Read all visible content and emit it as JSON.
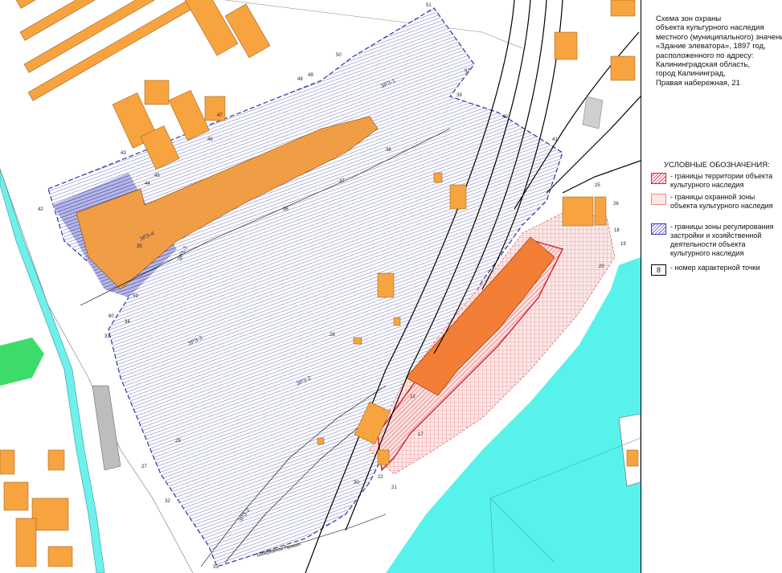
{
  "title": {
    "lines": [
      "Схема зон охраны",
      "объекта культурного наследия",
      "местного (муниципального) значения",
      "«Здание элеватора», 1897 год,",
      "расположенного по адресу:",
      "Калининградская область,",
      "город Калининград,",
      "Правая набережная, 21"
    ]
  },
  "legend": {
    "heading": "УСЛОВНЫЕ ОБОЗНАЧЕНИЯ:",
    "items": [
      {
        "swatch": "red-hatch",
        "text": "- границы территории объекта культурного наследия"
      },
      {
        "swatch": "pink",
        "text": "- границы охранной зоны объекта культурного наследия"
      },
      {
        "swatch": "blue-hatch",
        "text": "- границы зоны регулирования застройки и хозяйственной деятельности объекта культурного наследия"
      },
      {
        "swatch": "point-number",
        "swatch_label": "8",
        "text": "- номер характерной точки"
      }
    ]
  },
  "map": {
    "zone_labels": [
      "ЗРЗ-4",
      "ЗРЗ-3",
      "ЗРЗ-2",
      "ЗРЗ-1",
      "ЗРЗ-3",
      "ЗРЗ-2"
    ],
    "street_label": "набережная Правая",
    "point_numbers": [
      "51",
      "52",
      "50",
      "49",
      "48",
      "47",
      "46",
      "45",
      "44",
      "43",
      "42",
      "41",
      "40",
      "39",
      "38",
      "37",
      "36",
      "35",
      "34",
      "33",
      "32",
      "31",
      "30",
      "29",
      "28",
      "27",
      "26",
      "25",
      "22",
      "21",
      "20",
      "19",
      "18",
      "17",
      "12",
      "60",
      "59"
    ],
    "colors": {
      "water": "#58f2ec",
      "building": "#f7a340",
      "heritage_building": "#f7843a",
      "regulation_zone": "#3a3f9e",
      "protection_zone": "#f07a7a",
      "heritage_territory": "#e0202c",
      "railway": "#000000",
      "green": "#3ddc6a"
    }
  }
}
